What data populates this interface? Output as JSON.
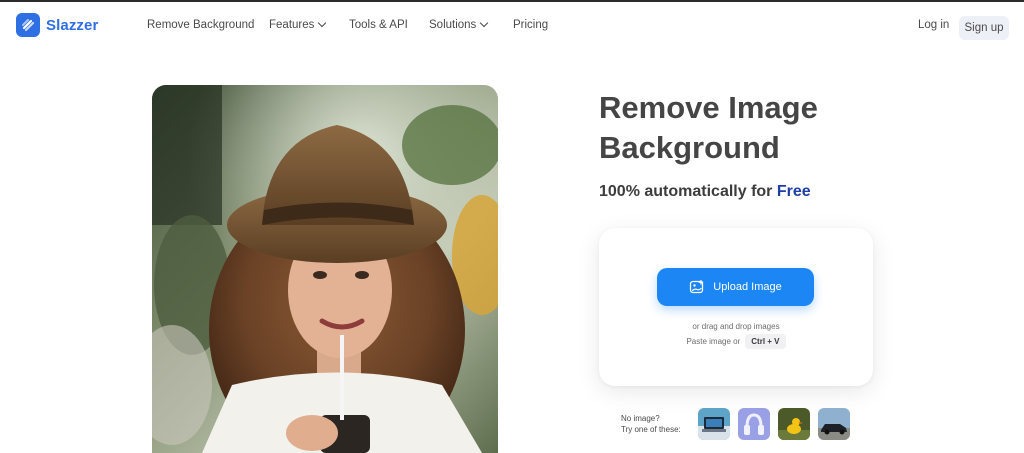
{
  "brand": {
    "name": "Slazzer",
    "accent": "#2f6fe4"
  },
  "nav": {
    "items": [
      {
        "label": "Remove Background",
        "dropdown": false
      },
      {
        "label": "Features",
        "dropdown": true
      },
      {
        "label": "Tools & API",
        "dropdown": false
      },
      {
        "label": "Solutions",
        "dropdown": true
      },
      {
        "label": "Pricing",
        "dropdown": false
      }
    ],
    "login": "Log in",
    "signup": "Sign up"
  },
  "hero": {
    "title_line1": "Remove Image",
    "title_line2": "Background",
    "subtitle_prefix": "100% automatically for",
    "subtitle_free": "Free",
    "free_color": "#1f3fa8"
  },
  "upload": {
    "button_label": "Upload Image",
    "button_icon": "image-upload-icon",
    "button_color": "#1d86f5",
    "drag_text": "or drag and drop images",
    "paste_text": "Paste image or",
    "shortcut": "Ctrl + V"
  },
  "samples": {
    "label_line1": "No image?",
    "label_line2": "Try one of these:",
    "items": [
      {
        "name": "laptop-sample"
      },
      {
        "name": "headphones-sample"
      },
      {
        "name": "duck-sample"
      },
      {
        "name": "car-sample"
      }
    ]
  }
}
